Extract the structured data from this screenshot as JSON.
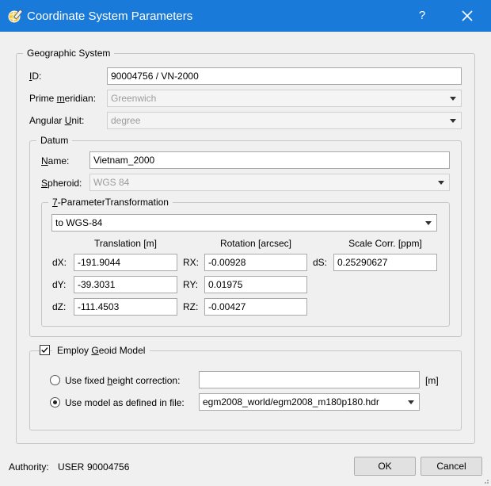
{
  "window": {
    "title": "Coordinate System Parameters",
    "help_label": "?",
    "icons": {
      "app": "globe-pencil-icon",
      "close": "close-icon"
    }
  },
  "geographic_system": {
    "title": "Geographic System",
    "id_label": "ID:",
    "id_value": "90004756 / VN-2000",
    "prime_meridian_label": "Prime meridian:",
    "prime_meridian_value": "Greenwich",
    "angular_unit_label": "Angular Unit:",
    "angular_unit_value": "degree"
  },
  "datum": {
    "title": "Datum",
    "name_label": "Name:",
    "name_value": "Vietnam_2000",
    "spheroid_label": "Spheroid:",
    "spheroid_value": "WGS 84"
  },
  "transformation": {
    "title": "7-ParameterTransformation",
    "target_value": "to WGS-84",
    "translation_header": "Translation [m]",
    "rotation_header": "Rotation [arcsec]",
    "scale_header": "Scale Corr. [ppm]",
    "dx_label": "dX:",
    "dx_value": "-191.9044",
    "dy_label": "dY:",
    "dy_value": "-39.3031",
    "dz_label": "dZ:",
    "dz_value": "-111.4503",
    "rx_label": "RX:",
    "rx_value": "-0.00928",
    "ry_label": "RY:",
    "ry_value": "0.01975",
    "rz_label": "RZ:",
    "rz_value": "-0.00427",
    "ds_label": "dS:",
    "ds_value": "0.25290627"
  },
  "geoid": {
    "title": "Employ Geoid Model",
    "checked": true,
    "fixed_label": "Use fixed height correction:",
    "fixed_value": "",
    "fixed_unit": "[m]",
    "model_label": "Use model as defined in file:",
    "model_value": "egm2008_world/egm2008_m180p180.hdr",
    "selected": "model"
  },
  "footer": {
    "authority_label": "Authority:",
    "authority_value": "USER",
    "authority_code": "90004756",
    "ok_label": "OK",
    "cancel_label": "Cancel"
  }
}
